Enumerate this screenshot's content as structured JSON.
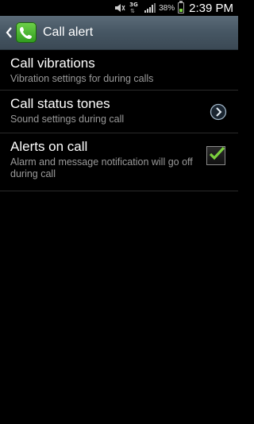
{
  "status_bar": {
    "network": "3G",
    "battery_percent": "38%",
    "battery_level": 0.38,
    "time": "2:39 PM",
    "icons": [
      "mute-icon",
      "network-3g-icon",
      "signal-icon",
      "battery-icon"
    ]
  },
  "header": {
    "title": "Call alert",
    "back_icon": "chevron-left-icon",
    "app_icon": "phone-icon"
  },
  "settings": [
    {
      "title": "Call vibrations",
      "subtitle": "Vibration settings for during calls"
    },
    {
      "title": "Call status tones",
      "subtitle": "Sound settings during call",
      "control": "chevron-right-icon"
    },
    {
      "title": "Alerts on call",
      "subtitle": "Alarm and message notification will go off during call",
      "control": "checkbox",
      "checked": true
    }
  ],
  "colors": {
    "accent": "#7bd13e",
    "header": "#465663",
    "subtitle": "#9a9a9a"
  }
}
